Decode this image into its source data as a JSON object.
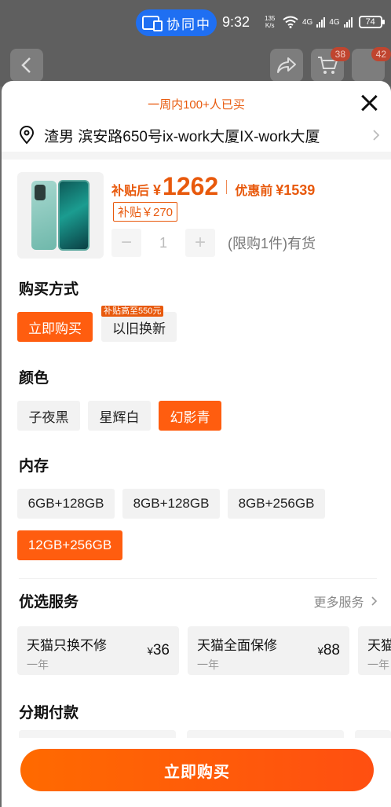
{
  "status_bar": {
    "cast_label": "协同中",
    "time": "9:32",
    "net_speed_value": "135",
    "net_speed_unit": "K/s",
    "signal_1": "4G",
    "signal_2": "4G",
    "battery": "74"
  },
  "nav": {
    "cart_badge": "38",
    "more_badge": "42"
  },
  "sheet": {
    "promo": "一周内100+人已买",
    "address": "渣男 滨安路650号ix-work大厦IX-work大厦"
  },
  "product": {
    "price_label": "补贴后",
    "currency": "¥",
    "price": "1262",
    "orig_label": "优惠前",
    "orig_price": "¥1539",
    "subsidy_tag": "补贴￥270",
    "qty_minus": "−",
    "qty": "1",
    "qty_plus": "+",
    "limit": "(限购1件)有货"
  },
  "purchase_method": {
    "title": "购买方式",
    "options": [
      "立即购买",
      "以旧换新"
    ],
    "badge": "补贴高至550元",
    "selected_index": 0
  },
  "color": {
    "title": "颜色",
    "options": [
      "子夜黑",
      "星辉白",
      "幻影青"
    ],
    "selected_index": 2
  },
  "memory": {
    "title": "内存",
    "options": [
      "6GB+128GB",
      "8GB+128GB",
      "8GB+256GB",
      "12GB+256GB"
    ],
    "selected_index": 3
  },
  "services": {
    "title": "优选服务",
    "more": "更多服务",
    "items": [
      {
        "name": "天猫只换不修",
        "term": "一年",
        "currency": "¥",
        "price": "36"
      },
      {
        "name": "天猫全面保修",
        "term": "一年",
        "currency": "¥",
        "price": "88"
      },
      {
        "name": "天猫",
        "term": "一年",
        "currency": "",
        "price": ""
      }
    ]
  },
  "installment": {
    "title": "分期付款"
  },
  "buy_button": "立即购买",
  "colors": {
    "accent": "#ff5d0f",
    "price": "#e8590c",
    "cast_pill": "#1f6ff2"
  }
}
